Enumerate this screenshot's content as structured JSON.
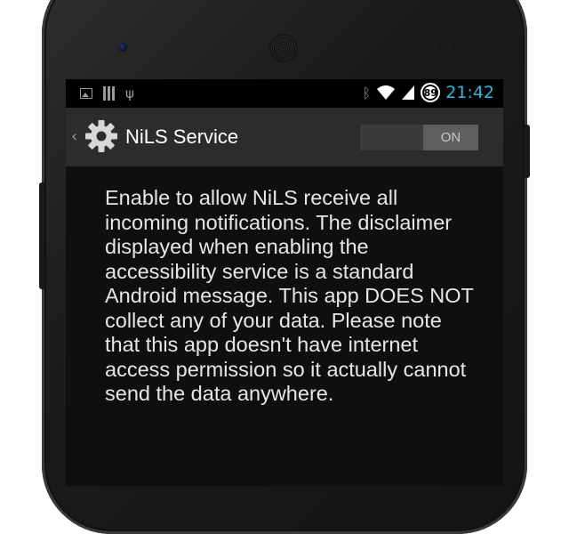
{
  "status_bar": {
    "icons_left": [
      "gallery-icon",
      "barcode-icon",
      "usb-icon"
    ],
    "icons_right": [
      "bluetooth-icon",
      "wifi-icon",
      "signal-icon"
    ],
    "battery_level": "89",
    "time": "21:42"
  },
  "action_bar": {
    "title": "NiLS Service",
    "toggle_label": "ON",
    "toggle_on": true
  },
  "main": {
    "description": "Enable to allow NiLS receive all incoming notifications. The disclaimer displayed when enabling the accessibility service is a standard Android message. This app DOES NOT collect any of your data. Please note that this app doesn't have internet access permission so it actually cannot send the data anywhere."
  },
  "colors": {
    "clock": "#33b5e5",
    "action_bar": "#2c2c2c",
    "screen_bg": "#0f0f0f"
  }
}
